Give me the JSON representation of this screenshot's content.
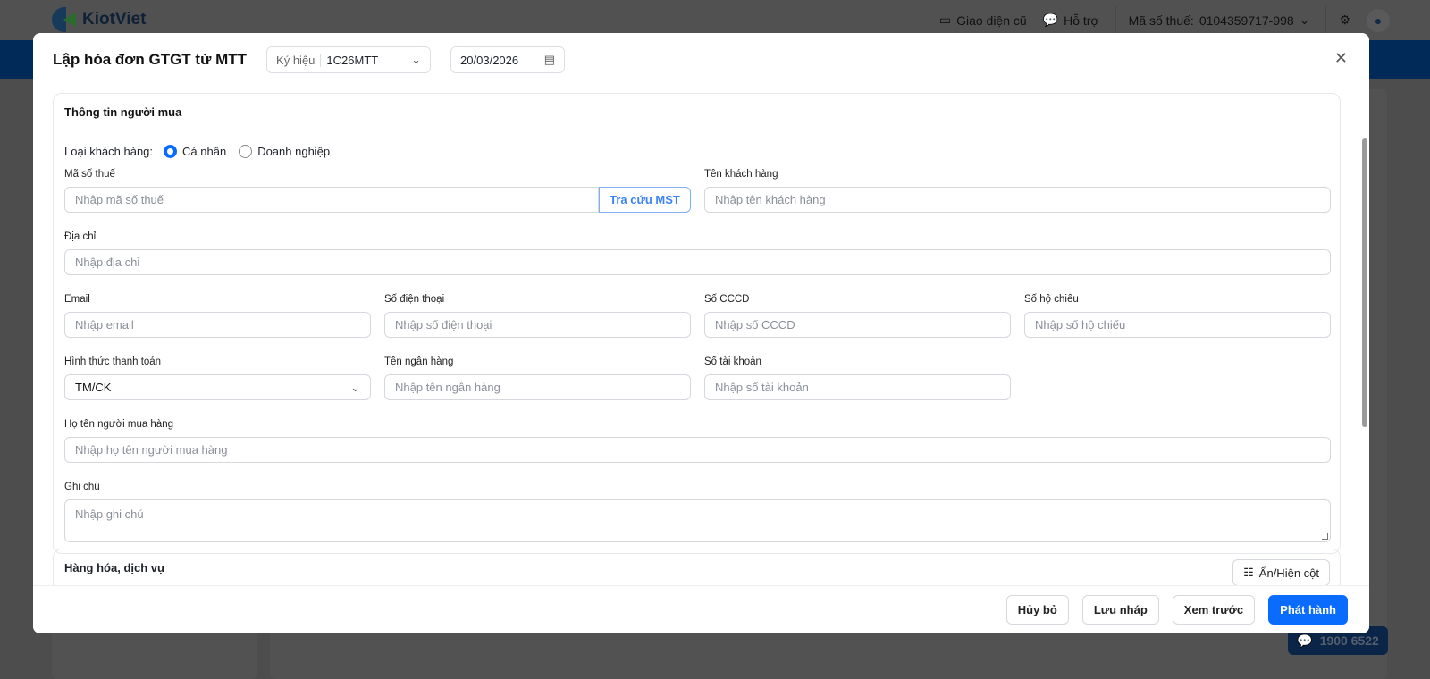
{
  "topbar": {
    "brand": "KiotViet",
    "old_ui": "Giao diện cũ",
    "support": "Hỗ trợ",
    "tax_label": "Mã số thuế:",
    "tax_value": "0104359717-998"
  },
  "hotline": "1900 6522",
  "modal": {
    "title": "Lập hóa đơn GTGT từ MTT",
    "symbol_label": "Ký hiệu",
    "symbol_value": "1C26MTT",
    "date": "20/03/2026",
    "buyer": {
      "section_title": "Thông tin người mua",
      "customer_type_label": "Loại khách hàng:",
      "customer_types": [
        {
          "label": "Cá nhân",
          "checked": true
        },
        {
          "label": "Doanh nghiệp",
          "checked": false
        }
      ],
      "tax_code": {
        "label": "Mã số thuế",
        "placeholder": "Nhập mã số thuế",
        "lookup": "Tra cứu MST"
      },
      "customer_name": {
        "label": "Tên khách hàng",
        "placeholder": "Nhập tên khách hàng"
      },
      "address": {
        "label": "Địa chỉ",
        "placeholder": "Nhập địa chỉ"
      },
      "email": {
        "label": "Email",
        "placeholder": "Nhập email"
      },
      "phone": {
        "label": "Số điện thoại",
        "placeholder": "Nhập số điện thoại"
      },
      "cccd": {
        "label": "Số CCCD",
        "placeholder": "Nhập số CCCD"
      },
      "passport": {
        "label": "Số hộ chiếu",
        "placeholder": "Nhập số hộ chiếu"
      },
      "payment": {
        "label": "Hình thức thanh toán",
        "value": "TM/CK"
      },
      "bank": {
        "label": "Tên ngân hàng",
        "placeholder": "Nhập tên ngân hàng"
      },
      "account": {
        "label": "Số tài khoản",
        "placeholder": "Nhập số tài khoản"
      },
      "buyer_name": {
        "label": "Họ tên người mua hàng",
        "placeholder": "Nhập họ tên người mua hàng"
      },
      "note": {
        "label": "Ghi chú",
        "placeholder": "Nhập ghi chú"
      }
    },
    "goods": {
      "section_title": "Hàng hóa, dịch vụ",
      "toggle_columns": "Ẩn/Hiện cột"
    },
    "footer": {
      "cancel": "Hủy bỏ",
      "save_draft": "Lưu nháp",
      "preview": "Xem trước",
      "issue": "Phát hành"
    }
  }
}
